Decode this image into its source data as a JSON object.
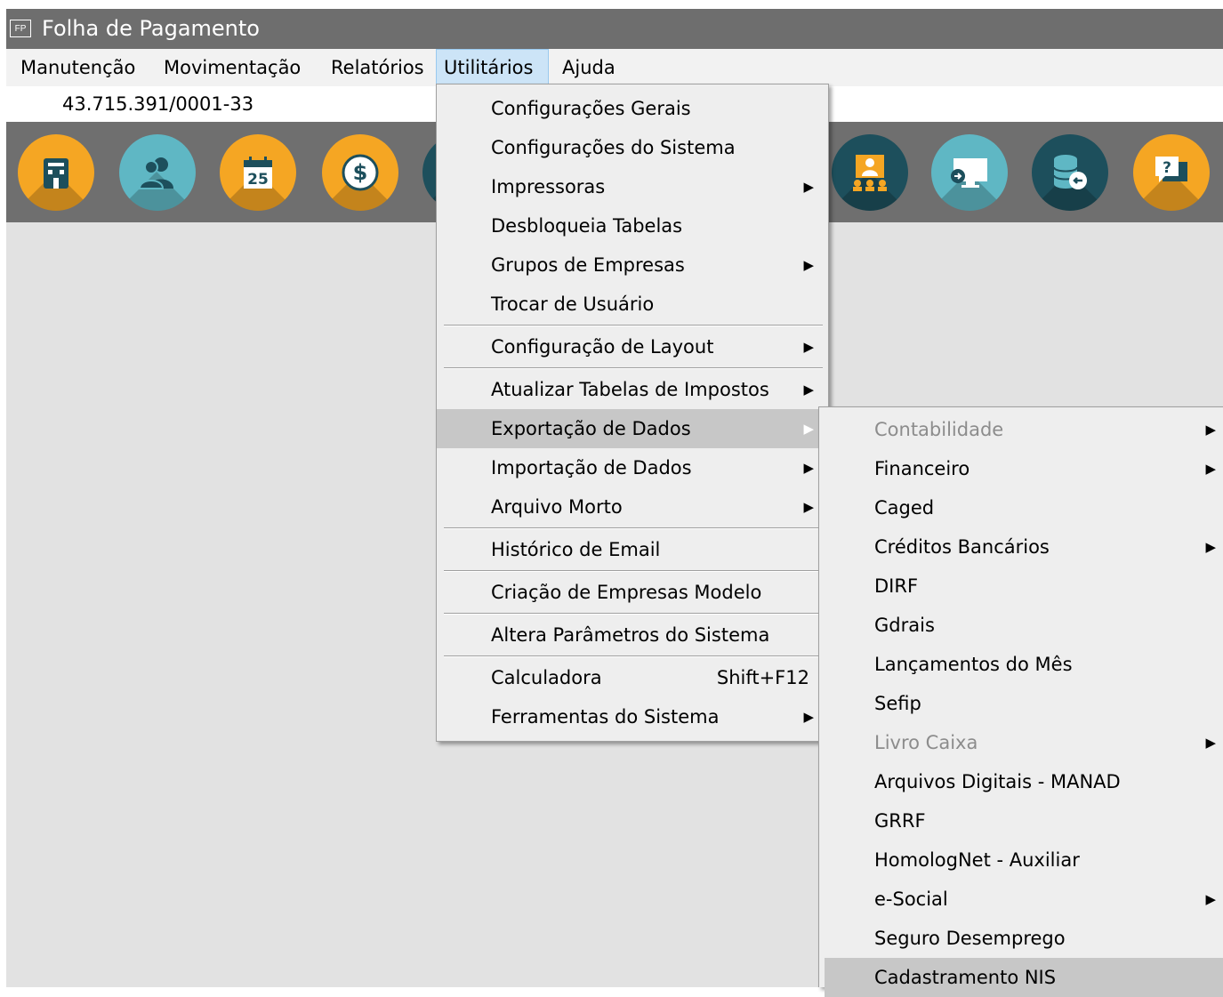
{
  "window": {
    "title": "Folha de Pagamento",
    "icon_text": "FP"
  },
  "menubar": [
    "Manutenção",
    "Movimentação",
    "Relatórios",
    "Utilitários",
    "Ajuda"
  ],
  "company": {
    "cnpj": "43.715.391/0001-33"
  },
  "toolbar_icons": [
    "building-icon",
    "people-icon",
    "calendar-icon",
    "money-icon",
    "partial-icon",
    "presentation-icon",
    "monitor-icon",
    "database-icon",
    "help-chat-icon"
  ],
  "calendar_day": "25",
  "colors": {
    "accent_orange": "#f5a623",
    "accent_teal": "#5fb7c4",
    "accent_dark": "#1d4f5c",
    "highlight": "#c7c7c7"
  },
  "utilitarios_menu": [
    {
      "label": "Configurações Gerais"
    },
    {
      "label": "Configurações do Sistema"
    },
    {
      "label": "Impressoras",
      "submenu": true
    },
    {
      "label": "Desbloqueia Tabelas"
    },
    {
      "label": "Grupos de Empresas",
      "submenu": true
    },
    {
      "label": "Trocar de Usuário"
    },
    {
      "label": "Configuração de Layout",
      "submenu": true
    },
    {
      "label": "Atualizar Tabelas de Impostos",
      "submenu": true
    },
    {
      "label": "Exportação de Dados",
      "submenu": true,
      "highlighted": true
    },
    {
      "label": "Importação de Dados",
      "submenu": true
    },
    {
      "label": "Arquivo Morto",
      "submenu": true
    },
    {
      "label": "Histórico de Email"
    },
    {
      "label": "Criação de Empresas Modelo"
    },
    {
      "label": "Altera Parâmetros do Sistema"
    },
    {
      "label": "Calculadora",
      "shortcut": "Shift+F12"
    },
    {
      "label": "Ferramentas do Sistema",
      "submenu": true
    }
  ],
  "exportacao_menu": [
    {
      "label": "Contabilidade",
      "submenu": true,
      "disabled": true
    },
    {
      "label": "Financeiro",
      "submenu": true
    },
    {
      "label": "Caged"
    },
    {
      "label": "Créditos Bancários",
      "submenu": true
    },
    {
      "label": "DIRF"
    },
    {
      "label": "Gdrais"
    },
    {
      "label": "Lançamentos do Mês"
    },
    {
      "label": "Sefip"
    },
    {
      "label": "Livro Caixa",
      "submenu": true,
      "disabled": true
    },
    {
      "label": "Arquivos Digitais - MANAD"
    },
    {
      "label": "GRRF"
    },
    {
      "label": "HomologNet - Auxiliar"
    },
    {
      "label": "e-Social",
      "submenu": true
    },
    {
      "label": "Seguro Desemprego"
    },
    {
      "label": "Cadastramento NIS",
      "highlighted": true
    }
  ]
}
